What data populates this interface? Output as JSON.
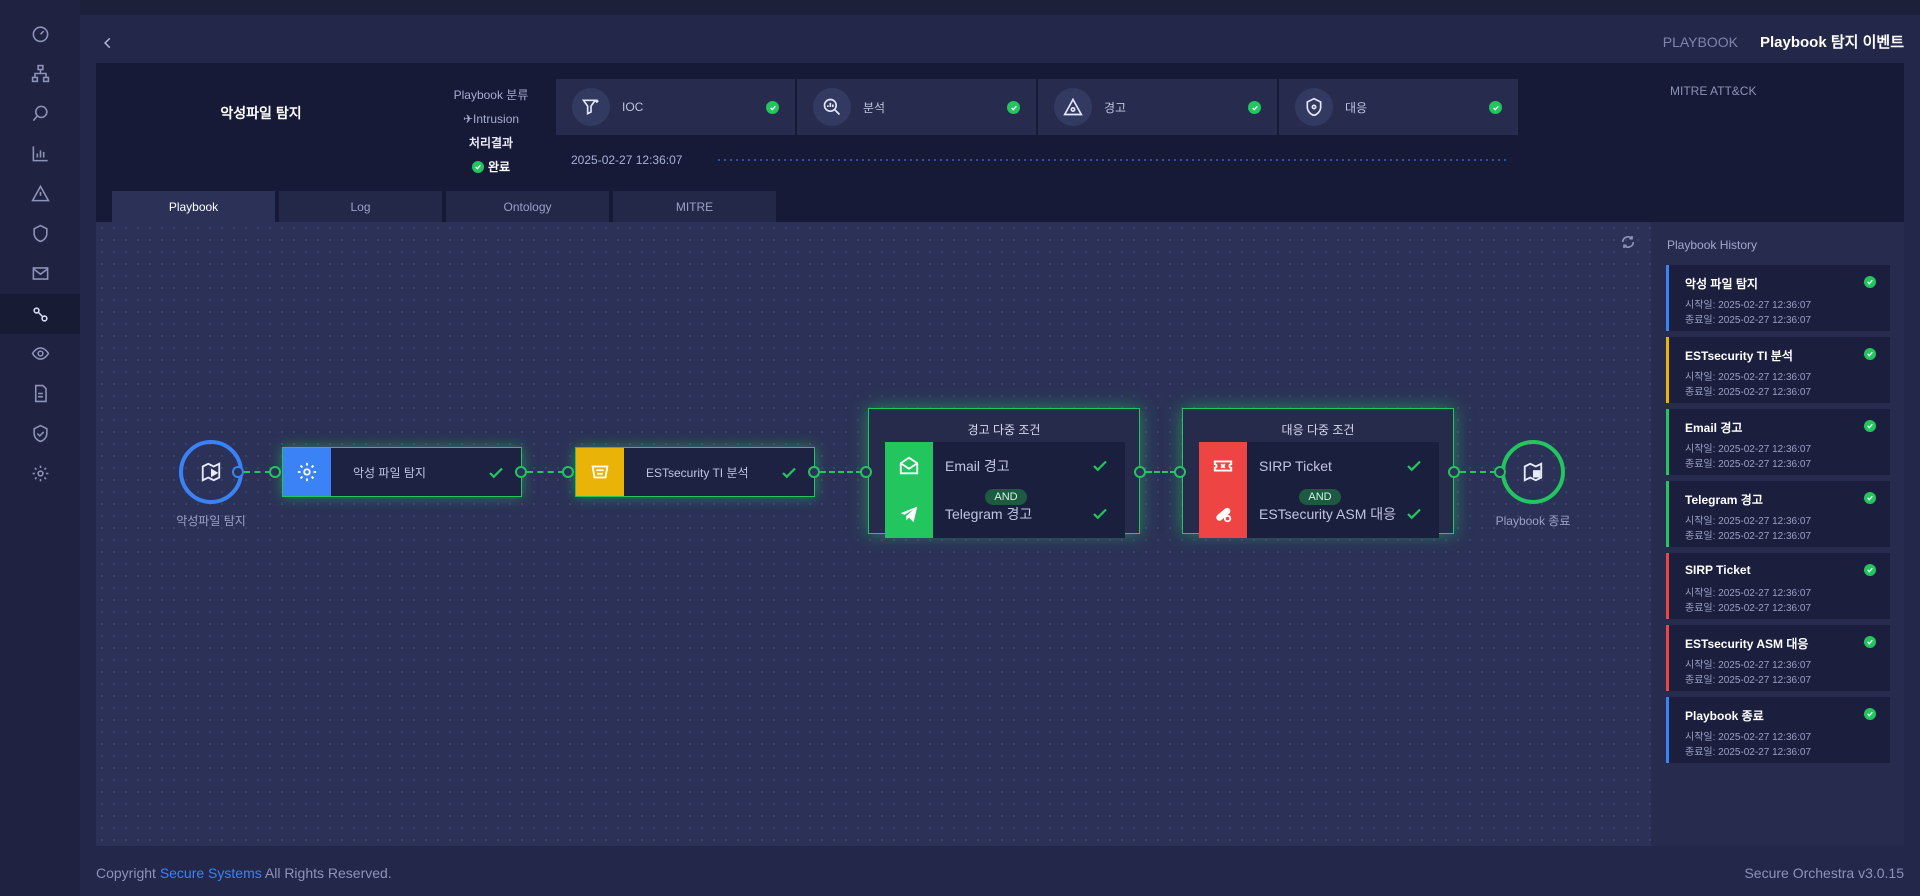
{
  "sidebar": {
    "items": [
      {
        "icon": "dashboard-icon"
      },
      {
        "icon": "network-icon"
      },
      {
        "icon": "search-icon"
      },
      {
        "icon": "chart-icon"
      },
      {
        "icon": "warning-icon"
      },
      {
        "icon": "shield-icon"
      },
      {
        "icon": "mail-icon"
      },
      {
        "icon": "playbook-icon",
        "active": true
      },
      {
        "icon": "eye-icon"
      },
      {
        "icon": "document-icon"
      },
      {
        "icon": "shield-check-icon"
      },
      {
        "icon": "settings-icon"
      }
    ]
  },
  "header": {
    "breadcrumb": [
      "PLAYBOOK",
      "Playbook 탐지 이벤트"
    ]
  },
  "event": {
    "title": "악성파일 탐지",
    "category_label": "Playbook 분류",
    "category_value": "Intrusion",
    "result_label": "처리결과",
    "result_value": "완료"
  },
  "stages": [
    {
      "label": "IOC",
      "icon": "filter-icon"
    },
    {
      "label": "분석",
      "icon": "analysis-icon"
    },
    {
      "label": "경고",
      "icon": "alert-icon"
    },
    {
      "label": "대응",
      "icon": "shield-icon"
    }
  ],
  "timestamp": "2025-02-27 12:36:07",
  "mitre_header": "MITRE ATT&CK",
  "tabs": [
    "Playbook",
    "Log",
    "Ontology",
    "MITRE"
  ],
  "flow": {
    "start_label": "악성파일 탐지",
    "task1": "악성 파일 탐지",
    "task2": "ESTsecurity TI 분석",
    "group1": {
      "title": "경고 다중 조건",
      "items": [
        "Email 경고",
        "Telegram 경고"
      ],
      "operator": "AND"
    },
    "group2": {
      "title": "대응 다중 조건",
      "items": [
        "SIRP Ticket",
        "ESTsecurity ASM 대응"
      ],
      "operator": "AND"
    },
    "end_label": "Playbook 종료"
  },
  "history": {
    "title": "Playbook History",
    "items": [
      {
        "title": "악성 파일 탐지",
        "start": "시작일: 2025-02-27 12:36:07",
        "end": "종료일: 2025-02-27 12:36:07",
        "color": "#3b82f6"
      },
      {
        "title": "ESTsecurity TI 분석",
        "start": "시작일: 2025-02-27 12:36:07",
        "end": "종료일: 2025-02-27 12:36:07",
        "color": "#eab308"
      },
      {
        "title": "Email 경고",
        "start": "시작일: 2025-02-27 12:36:07",
        "end": "종료일: 2025-02-27 12:36:07",
        "color": "#22c55e"
      },
      {
        "title": "Telegram 경고",
        "start": "시작일: 2025-02-27 12:36:07",
        "end": "종료일: 2025-02-27 12:36:07",
        "color": "#22c55e"
      },
      {
        "title": "SIRP Ticket",
        "start": "시작일: 2025-02-27 12:36:07",
        "end": "종료일: 2025-02-27 12:36:07",
        "color": "#ef4444"
      },
      {
        "title": "ESTsecurity ASM 대응",
        "start": "시작일: 2025-02-27 12:36:07",
        "end": "종료일: 2025-02-27 12:36:07",
        "color": "#ef4444"
      },
      {
        "title": "Playbook 종료",
        "start": "시작일: 2025-02-27 12:36:07",
        "end": "종료일: 2025-02-27 12:36:07",
        "color": "#3b82f6"
      }
    ]
  },
  "footer": {
    "copyright_prefix": "Copyright",
    "brand": "Secure Systems",
    "copyright_suffix": "All Rights Reserved.",
    "version": "Secure Orchestra v3.0.15"
  },
  "colors": {
    "accent_blue": "#3b82f6",
    "success_green": "#22c55e",
    "ti_yellow": "#eab308",
    "response_red": "#ef4444"
  }
}
